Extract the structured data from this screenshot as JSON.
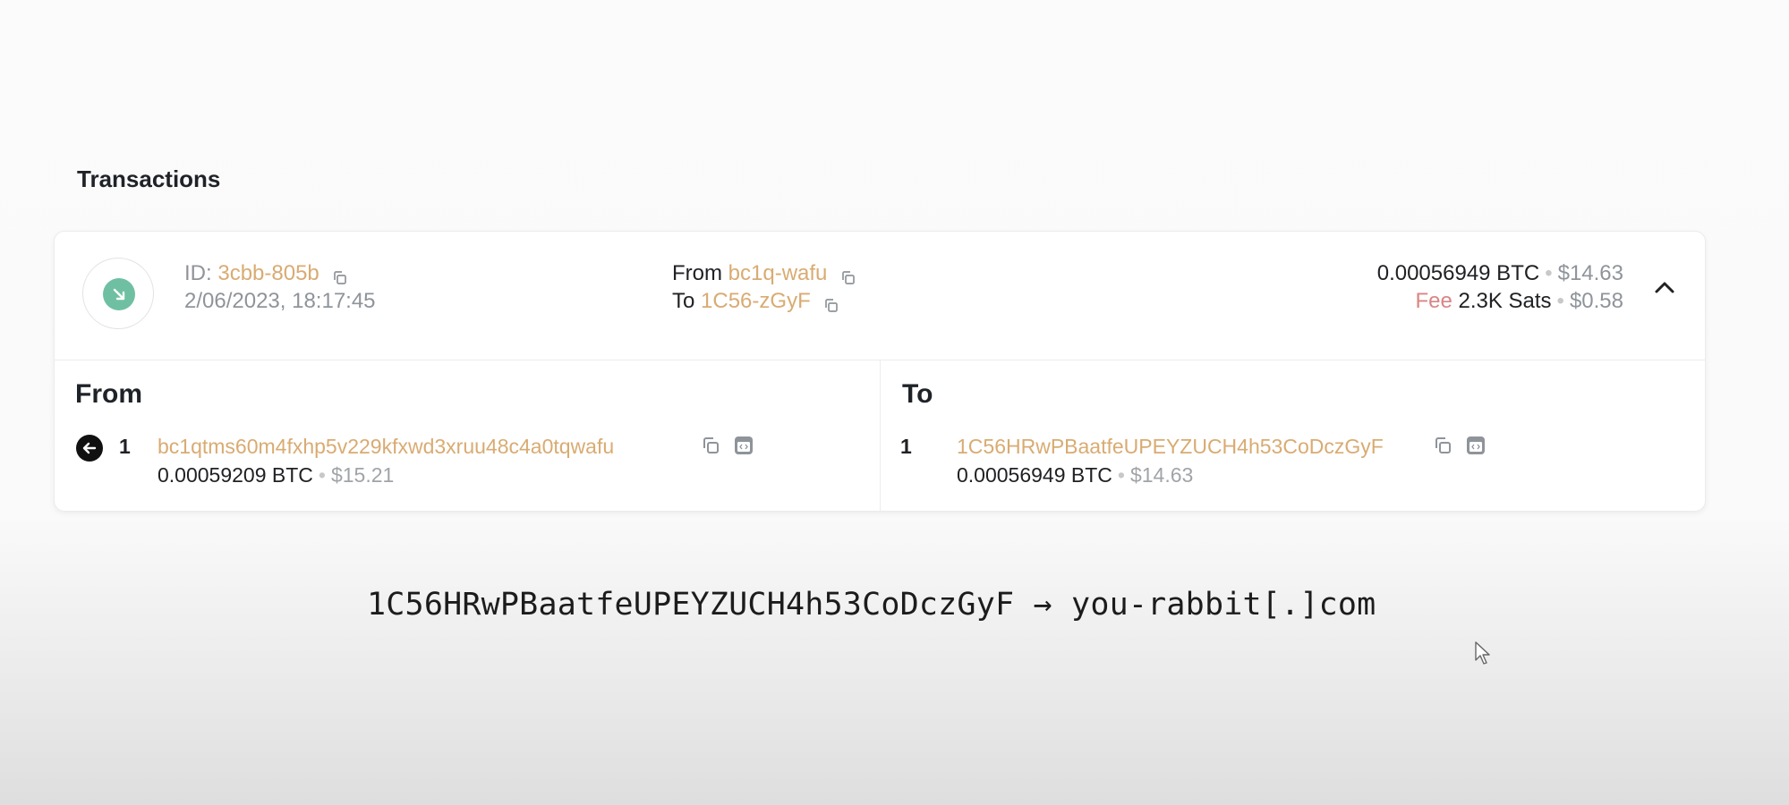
{
  "section_title": "Transactions",
  "transaction": {
    "id_label": "ID:",
    "id": "3cbb-805b",
    "datetime": "2/06/2023, 18:17:45",
    "from_label": "From",
    "from_short": "bc1q-wafu",
    "to_label": "To",
    "to_short": "1C56-zGyF",
    "amount_btc": "0.00056949 BTC",
    "amount_usd": "$14.63",
    "fee_label": "Fee",
    "fee_sats": "2.3K Sats",
    "fee_usd": "$0.58",
    "separator": "•",
    "direction_icon": "arrow-down-right-icon",
    "status_color": "#6fc0a2"
  },
  "details": {
    "from": {
      "heading": "From",
      "index": "1",
      "address": "bc1qtms60m4fxhp5v229kfxwd3xruu48c4a0tqwafu",
      "amount_btc": "0.00059209 BTC",
      "amount_usd": "$15.21"
    },
    "to": {
      "heading": "To",
      "index": "1",
      "address": "1C56HRwPBaatfeUPEYZUCH4h53CoDczGyF",
      "amount_btc": "0.00056949 BTC",
      "amount_usd": "$14.63"
    }
  },
  "caption": "1C56HRwPBaatfeUPEYZUCH4h53CoDczGyF → you-rabbit[.]com",
  "colors": {
    "address": "#d9ab72",
    "fee": "#d98585",
    "muted": "#8f949a"
  }
}
